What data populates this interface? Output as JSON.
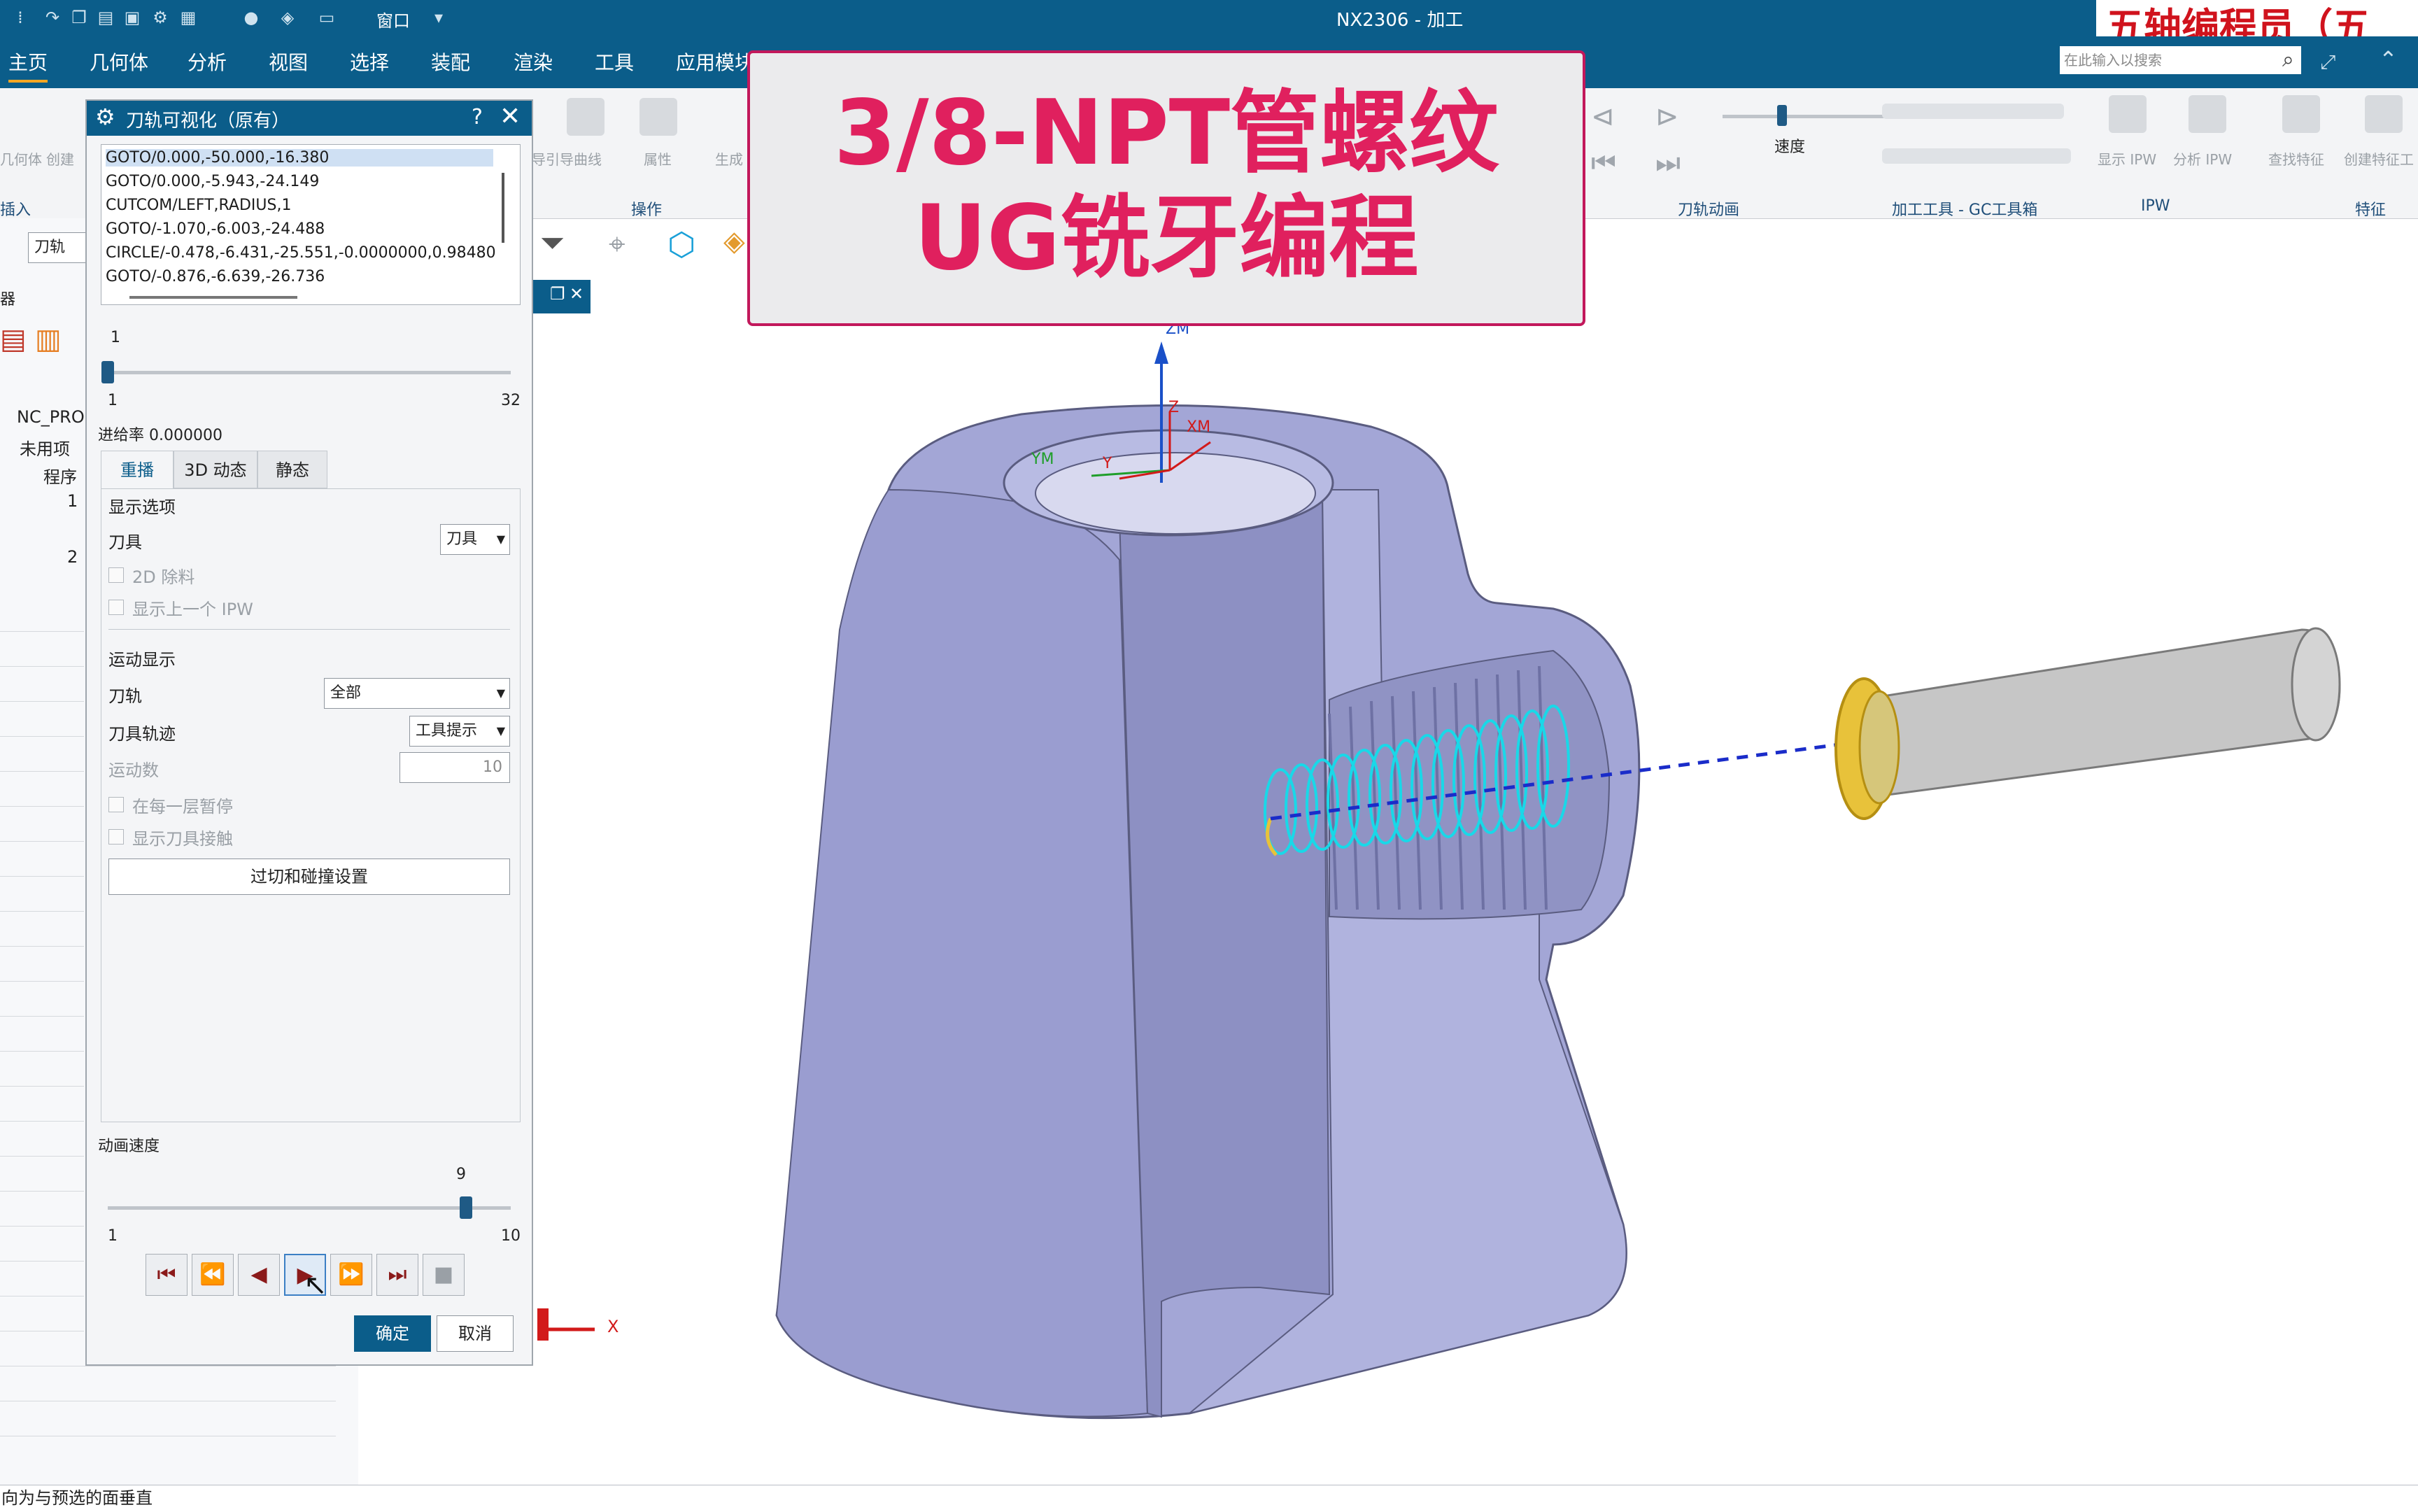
{
  "window": {
    "title": "NX2306 - 加工",
    "watermark": "五轴编程员（五"
  },
  "quick_access": {
    "window_menu_label": "窗口"
  },
  "menubar": {
    "items": [
      "主页",
      "几何体",
      "分析",
      "视图",
      "选择",
      "装配",
      "渲染",
      "工具",
      "应用模块"
    ],
    "search_placeholder": "在此输入以搜索"
  },
  "ribbon": {
    "left_labels": [
      "几何体",
      "创建"
    ],
    "labels": [
      "属性",
      "生成",
      "导引导曲线"
    ],
    "operation_group": "操作",
    "speed_label": "速度",
    "toolpath_anim_group": "刀轨动画",
    "machining_tools_group": "加工工具 - GC工具箱",
    "ipw_group": "IPW",
    "ipw_labels": [
      "显示 IPW",
      "分析 IPW"
    ],
    "feature_group": "特征",
    "feature_labels": [
      "查找特征",
      "创建特征工"
    ]
  },
  "navigator": {
    "insert_label": "插入",
    "filter_value": "刀轨",
    "panel_label": "器",
    "tree": [
      "NC_PRO",
      "未用项",
      "程序",
      "1",
      "2"
    ]
  },
  "banner": {
    "line1": "3/8-NPT管螺纹",
    "line2": "UG铣牙编程"
  },
  "viewport": {
    "axis_labels": {
      "zm": "ZM",
      "z": "Z",
      "xm": "XM",
      "y": "Y",
      "ym": "YM",
      "x": "X"
    },
    "colors": {
      "part": "#a3a6d6",
      "part_dark": "#8d90c3",
      "helix": "#19d8e8",
      "tool_body": "#c6c6c6",
      "tool_tip": "#e8c23a",
      "toolpath_dash": "#1a2cc9"
    }
  },
  "dialog": {
    "title": "刀轨可视化（原有）",
    "list": [
      "GOTO/0.000,-50.000,-16.380",
      "GOTO/0.000,-5.943,-24.149",
      "CUTCOM/LEFT,RADIUS,1",
      "GOTO/-1.070,-6.003,-24.488",
      "CIRCLE/-0.478,-6.431,-25.551,-0.0000000,0.98480",
      "GOTO/-0.876,-6.639,-26.736"
    ],
    "position_slider": {
      "value": 1,
      "min": 1,
      "max": 32
    },
    "feedrate": "进给率 0.000000",
    "tabs": [
      "重播",
      "3D 动态",
      "静态"
    ],
    "display_options_label": "显示选项",
    "tool_label": "刀具",
    "tool_value": "刀具",
    "chk_2d_material": "2D 除料",
    "chk_prev_ipw": "显示上一个 IPW",
    "motion_display_label": "运动显示",
    "path_label": "刀轨",
    "path_value": "全部",
    "path_trace_label": "刀具轨迹",
    "path_trace_value": "工具提示",
    "motion_count_label": "运动数",
    "motion_count_value": "10",
    "chk_pause_each_layer": "在每一层暂停",
    "chk_show_contact": "显示刀具接触",
    "gouge_button": "过切和碰撞设置",
    "anim_speed_label": "动画速度",
    "speed_slider": {
      "value": 9,
      "min": 1,
      "max": 10
    },
    "vcr": [
      "⏮",
      "⏪",
      "◀",
      "▶",
      "⏩",
      "⏭",
      "■"
    ],
    "ok": "确定",
    "cancel": "取消"
  },
  "status": {
    "text": "向为与预选的面垂直"
  }
}
